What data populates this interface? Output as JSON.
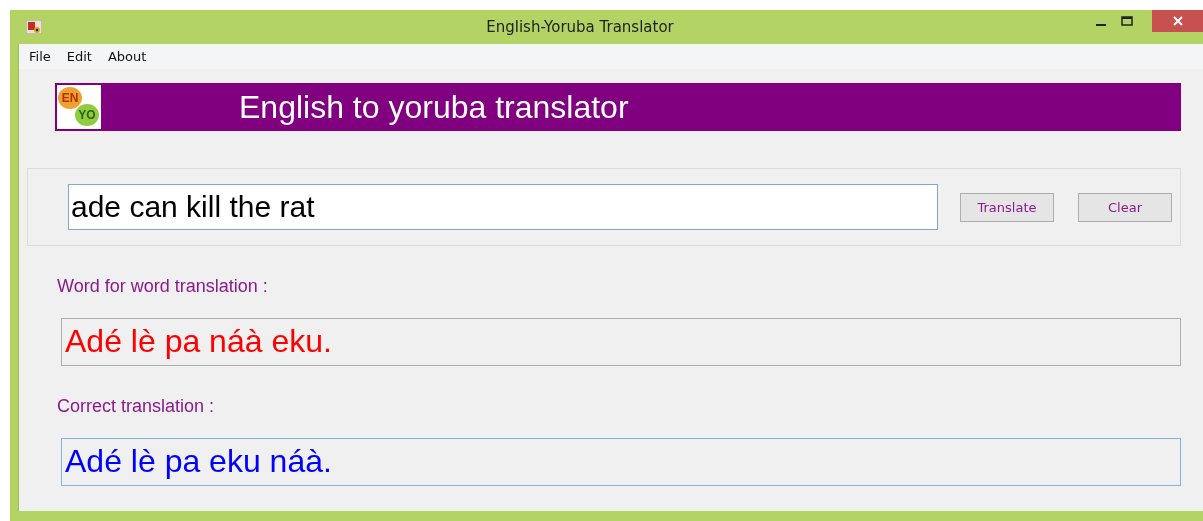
{
  "window": {
    "title": "English-Yoruba Translator"
  },
  "menu": [
    {
      "label": "File"
    },
    {
      "label": "Edit"
    },
    {
      "label": "About"
    }
  ],
  "banner": {
    "logo": {
      "top": "EN",
      "bottom": "YO"
    },
    "title": "English to yoruba translator"
  },
  "input": {
    "value": "ade can kill the rat"
  },
  "buttons": [
    {
      "label": "Translate"
    },
    {
      "label": "Clear"
    }
  ],
  "outputs": [
    {
      "label": "Word for word translation :",
      "value": "Adé lè pa náà eku.",
      "color": "#ff0000",
      "focused": false
    },
    {
      "label": "Correct translation :",
      "value": "Adé lè pa eku náà.",
      "color": "#0000ff",
      "focused": true
    }
  ]
}
